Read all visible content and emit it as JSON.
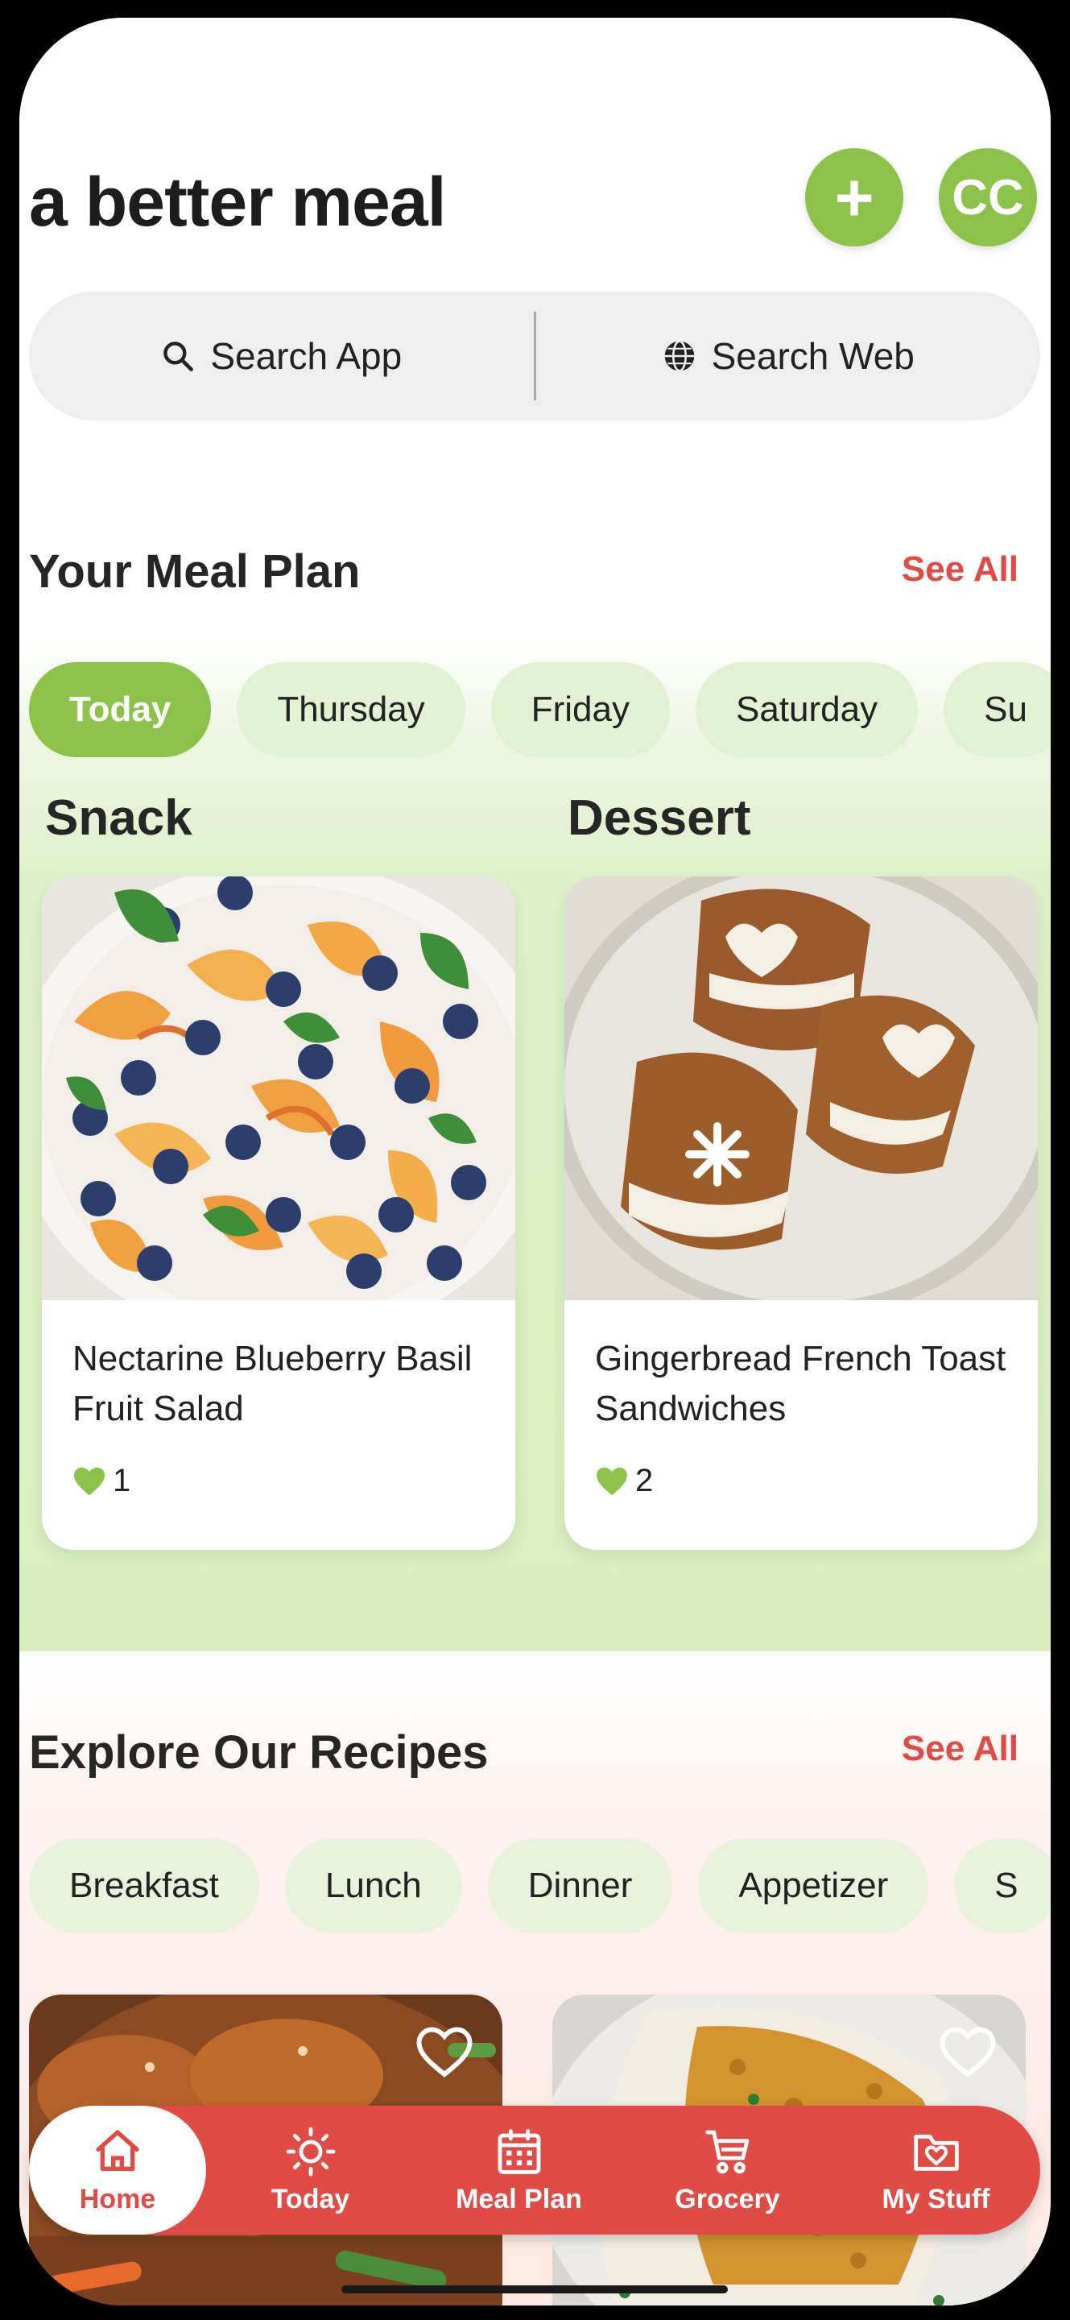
{
  "header": {
    "app_title": "a better meal",
    "add_label": "+",
    "avatar_initials": "CC",
    "search_app_label": "Search App",
    "search_web_label": "Search Web"
  },
  "meal_plan": {
    "title": "Your Meal Plan",
    "see_all": "See All",
    "days": [
      "Today",
      "Thursday",
      "Friday",
      "Saturday",
      "Su"
    ],
    "selected_day": "Today",
    "meals": [
      {
        "category": "Snack",
        "name": "Nectarine Blueberry Basil Fruit Salad",
        "likes": "1"
      },
      {
        "category": "Dessert",
        "name": "Gingerbread French Toast Sandwiches",
        "likes": "2"
      }
    ]
  },
  "explore": {
    "title": "Explore Our Recipes",
    "see_all": "See All",
    "categories": [
      "Breakfast",
      "Lunch",
      "Dinner",
      "Appetizer",
      "S"
    ]
  },
  "nav": {
    "items": [
      {
        "label": "Home",
        "icon": "home-icon",
        "active": true
      },
      {
        "label": "Today",
        "icon": "sun-icon",
        "active": false
      },
      {
        "label": "Meal Plan",
        "icon": "calendar-icon",
        "active": false
      },
      {
        "label": "Grocery",
        "icon": "cart-icon",
        "active": false
      },
      {
        "label": "My Stuff",
        "icon": "folder-heart-icon",
        "active": false
      }
    ]
  },
  "colors": {
    "brand_green": "#8bc34a",
    "brand_red": "#e04b45",
    "pill_green": "#e3f1d3"
  }
}
